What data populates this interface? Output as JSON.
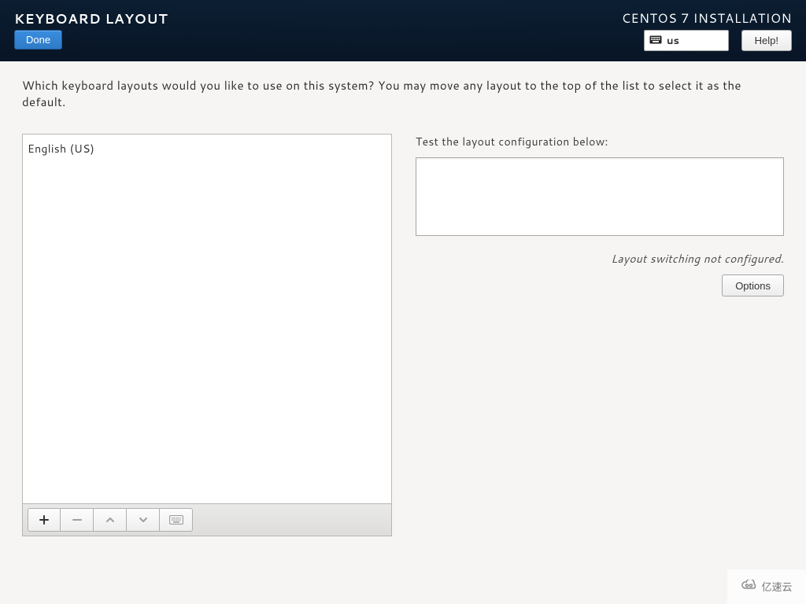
{
  "header": {
    "title": "KEYBOARD LAYOUT",
    "installer": "CENTOS 7 INSTALLATION",
    "done_label": "Done",
    "help_label": "Help!",
    "current_layout_code": "us"
  },
  "instructions": "Which keyboard layouts would you like to use on this system?  You may move any layout to the top of the list to select it as the default.",
  "layouts": {
    "items": [
      "English (US)"
    ]
  },
  "toolbar": {
    "add_tip": "Add layout",
    "remove_tip": "Remove layout",
    "up_tip": "Move up",
    "down_tip": "Move down",
    "preview_tip": "Preview layout"
  },
  "test": {
    "label": "Test the layout configuration below:",
    "value": ""
  },
  "switch_note": "Layout switching not configured.",
  "options_label": "Options",
  "watermark": "亿速云"
}
